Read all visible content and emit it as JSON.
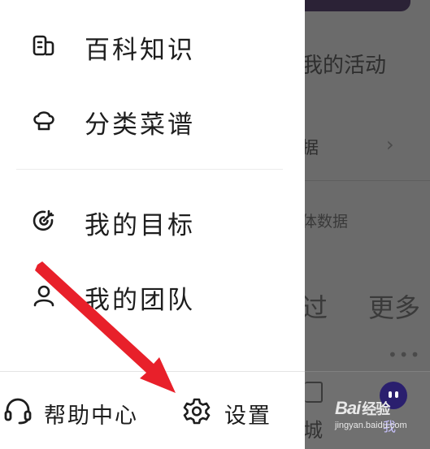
{
  "background": {
    "activity_text": "我的活动",
    "data_text": "据",
    "chevron": "›",
    "body_data_text": "体数据",
    "tab_past": "过",
    "tab_more": "更多",
    "dots": "•••",
    "mall_text": "城",
    "me_text": "我"
  },
  "drawer": {
    "menu": [
      {
        "label": "百科知识",
        "icon": "encyclopedia-book-icon"
      },
      {
        "label": "分类菜谱",
        "icon": "chef-hat-icon"
      },
      {
        "label": "我的目标",
        "icon": "target-icon"
      },
      {
        "label": "我的团队",
        "icon": "team-person-icon"
      }
    ],
    "footer": {
      "help_label": "帮助中心",
      "help_icon": "headset-icon",
      "settings_label": "设置",
      "settings_icon": "gear-icon"
    }
  },
  "watermark": {
    "logo": "Bai",
    "logo_jy": "经验",
    "url": "jingyan.baidu.com"
  },
  "colors": {
    "text": "#1d1d1d",
    "overlay": "#6b6b6b",
    "annotation_red": "#e8202a",
    "avatar": "#2a1f6e"
  }
}
